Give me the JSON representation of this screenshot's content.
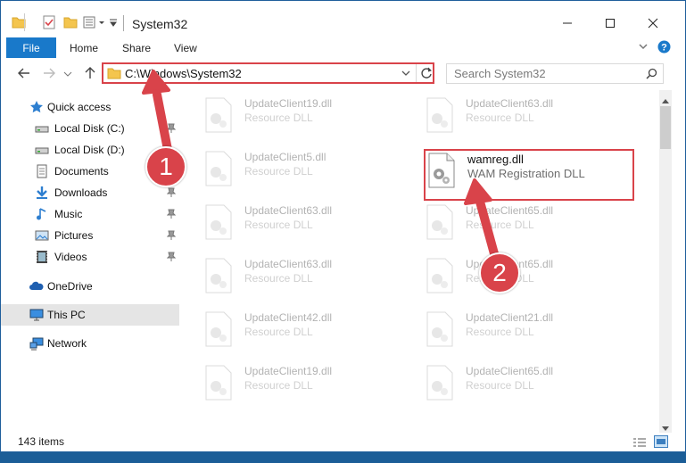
{
  "window": {
    "title": "System32"
  },
  "ribbon": {
    "file_tab": "File",
    "tabs": [
      "Home",
      "Share",
      "View"
    ]
  },
  "address": {
    "path": "C:\\Windows\\System32"
  },
  "search": {
    "placeholder": "Search System32"
  },
  "sidebar": {
    "items": [
      {
        "label": "Quick access",
        "icon": "star-icon"
      },
      {
        "label": "Local Disk (C:)",
        "icon": "drive-icon",
        "pinned": true
      },
      {
        "label": "Local Disk (D:)",
        "icon": "drive-icon",
        "pinned": true
      },
      {
        "label": "Documents",
        "icon": "documents-icon",
        "pinned": true
      },
      {
        "label": "Downloads",
        "icon": "download-icon",
        "pinned": true
      },
      {
        "label": "Music",
        "icon": "music-icon",
        "pinned": true
      },
      {
        "label": "Pictures",
        "icon": "pictures-icon",
        "pinned": true
      },
      {
        "label": "Videos",
        "icon": "videos-icon",
        "pinned": true
      },
      {
        "label": "OneDrive",
        "icon": "cloud-icon"
      },
      {
        "label": "This PC",
        "icon": "computer-icon",
        "selected": true
      },
      {
        "label": "Network",
        "icon": "network-icon"
      }
    ]
  },
  "files": {
    "left": [
      {
        "name": "UpdateClient19.dll",
        "type": "Resource DLL"
      },
      {
        "name": "UpdateClient5.dll",
        "type": "Resource DLL"
      },
      {
        "name": "UpdateClient63.dll",
        "type": "Resource DLL"
      },
      {
        "name": "UpdateClient63.dll",
        "type": "Resource DLL"
      },
      {
        "name": "UpdateClient42.dll",
        "type": "Resource DLL"
      },
      {
        "name": "UpdateClient19.dll",
        "type": "Resource DLL"
      }
    ],
    "right": [
      {
        "name": "UpdateClient63.dll",
        "type": "Resource DLL"
      },
      {
        "name": "wamreg.dll",
        "type": "WAM Registration DLL"
      },
      {
        "name": "UpdateClient65.dll",
        "type": "Resource DLL"
      },
      {
        "name": "UpdateClient65.dll",
        "type": "Resource DLL"
      },
      {
        "name": "UpdateClient21.dll",
        "type": "Resource DLL"
      },
      {
        "name": "UpdateClient65.dll",
        "type": "Resource DLL"
      }
    ]
  },
  "status": {
    "item_count": "143 items"
  },
  "annotations": {
    "step1": "1",
    "step2": "2",
    "color": "#d9434a"
  }
}
